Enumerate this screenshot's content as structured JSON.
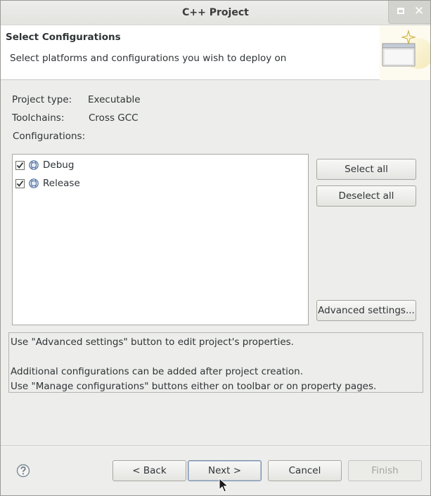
{
  "window": {
    "title": "C++ Project"
  },
  "header": {
    "title": "Select Configurations",
    "description": "Select platforms and configurations you wish to deploy on",
    "icon": "wizard-banner-icon"
  },
  "properties": {
    "project_type_label": "Project type:",
    "project_type_value": "Executable",
    "toolchains_label": "Toolchains:",
    "toolchains_value": "Cross GCC",
    "configurations_label": "Configurations:"
  },
  "configurations": [
    {
      "label": "Debug",
      "checked": true,
      "icon": "configuration-icon"
    },
    {
      "label": "Release",
      "checked": true,
      "icon": "configuration-icon"
    }
  ],
  "side_buttons": {
    "select_all": "Select all",
    "deselect_all": "Deselect all",
    "advanced_settings": "Advanced settings..."
  },
  "info": {
    "line1": "Use \"Advanced settings\" button to edit project's properties.",
    "line2": "Additional configurations can be added after project creation.",
    "line3": "Use \"Manage configurations\" buttons either on toolbar or on property pages."
  },
  "footer": {
    "back": "< Back",
    "next": "Next >",
    "cancel": "Cancel",
    "finish": "Finish",
    "finish_enabled": false
  },
  "colors": {
    "window_bg": "#ededeb",
    "banner_bg": "#ffffff",
    "disabled_text": "#a4a4a0"
  }
}
